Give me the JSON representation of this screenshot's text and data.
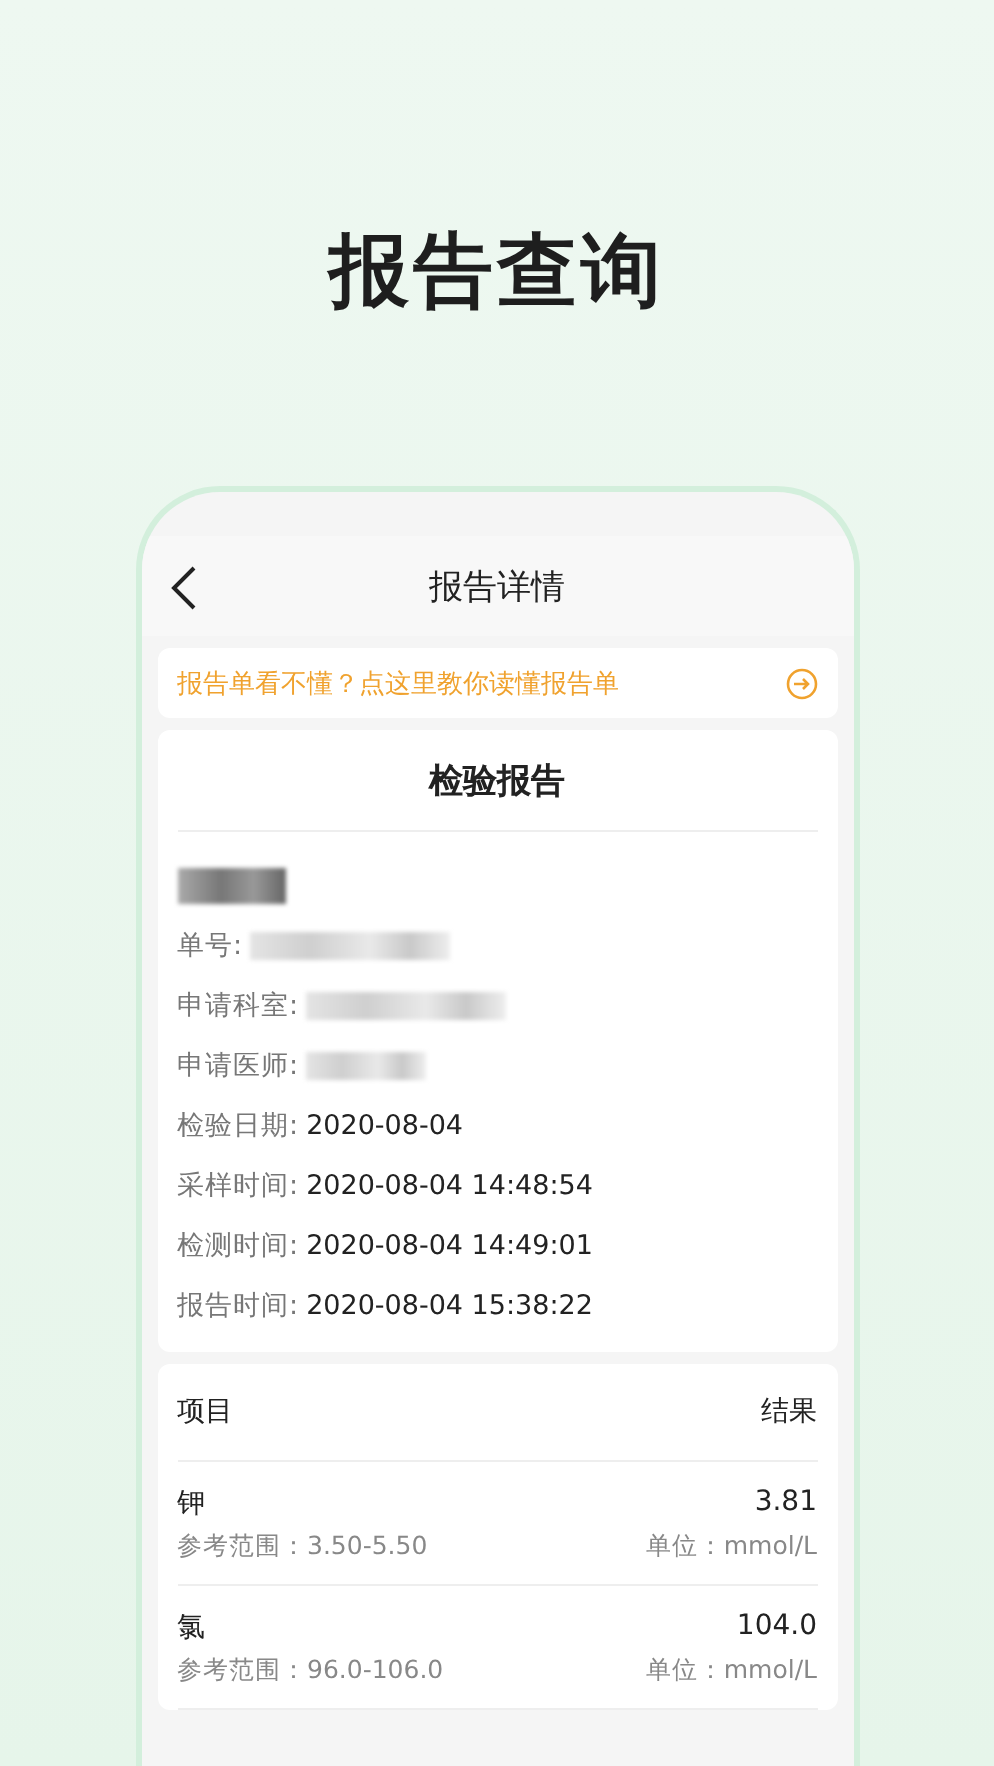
{
  "headline": "报告查询",
  "nav": {
    "title": "报告详情"
  },
  "banner": {
    "text": "报告单看不懂？点这里教你读懂报告单"
  },
  "report": {
    "title": "检验报告",
    "patient_redacted": true,
    "fields": [
      {
        "label": "单号:",
        "kind": "redacted"
      },
      {
        "label": "申请科室:",
        "kind": "redacted"
      },
      {
        "label": "申请医师:",
        "kind": "redacted"
      },
      {
        "label": "检验日期:",
        "kind": "text",
        "value": "2020-08-04"
      },
      {
        "label": "采样时间:",
        "kind": "text",
        "value": "2020-08-04 14:48:54"
      },
      {
        "label": "检测时间:",
        "kind": "text",
        "value": "2020-08-04 14:49:01"
      },
      {
        "label": "报告时间:",
        "kind": "text",
        "value": "2020-08-04 15:38:22"
      }
    ]
  },
  "results": {
    "columns": [
      "项目",
      "结果"
    ],
    "rows": [
      {
        "name": "钾",
        "result": "3.81",
        "range": "参考范围：3.50-5.50",
        "unit": "单位：mmol/L"
      },
      {
        "name": "氯",
        "result": "104.0",
        "range": "参考范围：96.0-106.0",
        "unit": "单位：mmol/L"
      }
    ]
  }
}
